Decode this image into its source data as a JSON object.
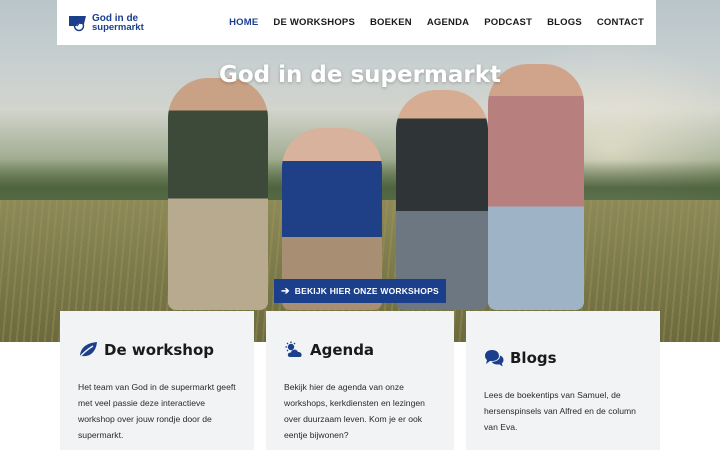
{
  "brand": {
    "line1": "God in de",
    "line2": "supermarkt",
    "color": "#1b3f8b"
  },
  "nav": {
    "items": [
      {
        "label": "HOME",
        "active": true
      },
      {
        "label": "DE WORKSHOPS",
        "active": false
      },
      {
        "label": "BOEKEN",
        "active": false
      },
      {
        "label": "AGENDA",
        "active": false
      },
      {
        "label": "PODCAST",
        "active": false
      },
      {
        "label": "BLOGS",
        "active": false
      },
      {
        "label": "CONTACT",
        "active": false
      }
    ]
  },
  "hero": {
    "title": "God in de supermarkt",
    "cta_label": "BEKIJK HIER ONZE WORKSHOPS",
    "cta_icon": "arrow-right-icon"
  },
  "cards": [
    {
      "icon": "leaf-icon",
      "title": "De workshop",
      "text": "Het team van God in de supermarkt geeft met veel passie deze interactieve workshop over jouw rondje door de supermarkt."
    },
    {
      "icon": "cloud-sun-icon",
      "title": "Agenda",
      "text": "Bekijk hier de agenda van onze workshops, kerkdiensten en lezingen over duurzaam leven. Kom je er ook eentje bijwonen?"
    },
    {
      "icon": "chat-bubbles-icon",
      "title": "Blogs",
      "text": "Lees de boekentips van Samuel, de hersenspinsels van Alfred en de column van Eva."
    }
  ]
}
